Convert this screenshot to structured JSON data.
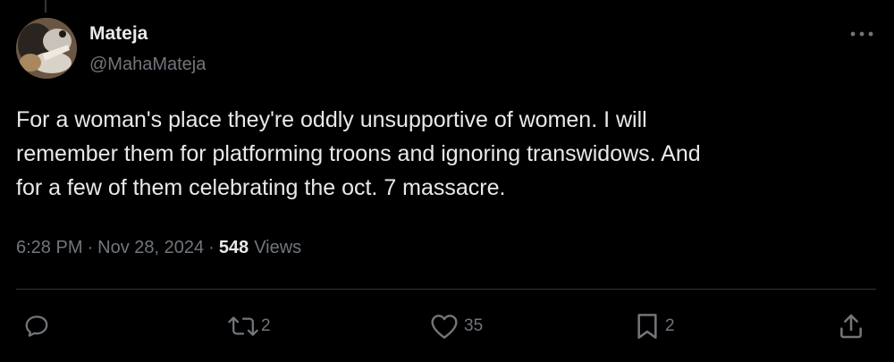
{
  "tweet": {
    "author_name": "Mateja",
    "author_handle": "@MahaMateja",
    "text": "For a woman's place they're oddly unsupportive of women. I will\nremember them for platforming troons and ignoring transwidows. And\nfor a few of them celebrating the oct. 7 massacre.",
    "time": "6:28 PM",
    "separator": "·",
    "date": "Nov 28, 2024",
    "views_count": "548",
    "views_label": "Views"
  },
  "actions": {
    "reply_count": "",
    "retweet_count": "2",
    "like_count": "35",
    "bookmark_count": "2"
  },
  "icons": {
    "reply": "reply-icon",
    "retweet": "retweet-icon",
    "like": "heart-icon",
    "bookmark": "bookmark-icon",
    "share": "share-icon",
    "more": "more-icon"
  },
  "colors": {
    "background": "#000000",
    "text_primary": "#e7e9ea",
    "text_secondary": "#71767b",
    "divider": "#2f3336"
  }
}
